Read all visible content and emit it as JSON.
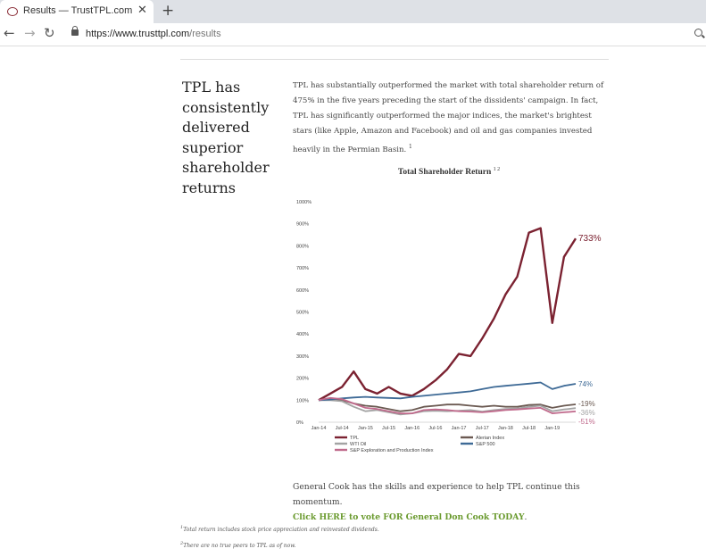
{
  "browser": {
    "tab_title": "Results — TrustTPL.com",
    "close_glyph": "✕",
    "newtab_glyph": "+",
    "url_host": "https://www.trusttpl.com",
    "url_path": "/results"
  },
  "page": {
    "headline": "TPL has consistently delivered superior shareholder returns",
    "intro": "TPL has substantially outperformed the market with total shareholder return of 475% in the five years preceding the start of the dissidents' campaign. In fact, TPL has significantly outperformed the major indices, the market's brightest stars (like Apple, Amazon and Facebook) and oil and gas companies invested heavily in the Permian Basin.",
    "intro_footnote_ref": "1",
    "chart_title": "Total Shareholder Return",
    "chart_title_refs": "1 2",
    "closing_text": "General Cook has the skills and experience to help TPL continue this momentum.",
    "cta_text": "Click HERE to vote FOR General Don Cook TODAY",
    "cta_suffix": ".",
    "footnote1_ref": "1",
    "footnote1": "Total return includes stock price appreciation and reinvested dividends.",
    "footnote2_ref": "2",
    "footnote2": "There are no true peers to TPL as of now."
  },
  "chart_data": {
    "type": "line",
    "ylim": [
      0,
      1000
    ],
    "yticks": [
      "0%",
      "100%",
      "200%",
      "300%",
      "400%",
      "500%",
      "600%",
      "700%",
      "800%",
      "900%",
      "1000%"
    ],
    "xticks": [
      "Jan-14",
      "Jul-14",
      "Jan-15",
      "Jul-15",
      "Jan-16",
      "Jul-16",
      "Jan-17",
      "Jul-17",
      "Jan-18",
      "Jul-18",
      "Jan-19"
    ],
    "x": [
      0,
      3,
      6,
      9,
      12,
      15,
      18,
      21,
      24,
      27,
      30,
      33,
      36,
      39,
      42,
      45,
      48,
      51,
      54,
      57,
      60,
      63,
      66
    ],
    "series": [
      {
        "name": "TPL",
        "color": "#7b2231",
        "end_label": "733%",
        "values": [
          100,
          130,
          160,
          230,
          150,
          130,
          160,
          130,
          120,
          150,
          190,
          240,
          310,
          300,
          380,
          470,
          580,
          660,
          860,
          880,
          450,
          750,
          833
        ]
      },
      {
        "name": "Alerian Index",
        "color": "#6b5a52",
        "end_label": "-19%",
        "values": [
          100,
          105,
          100,
          85,
          75,
          70,
          60,
          50,
          55,
          70,
          75,
          80,
          80,
          75,
          70,
          75,
          70,
          70,
          78,
          80,
          65,
          75,
          81
        ]
      },
      {
        "name": "WTI Oil",
        "color": "#a3a3a3",
        "end_label": "-36%",
        "values": [
          100,
          100,
          95,
          70,
          50,
          55,
          45,
          35,
          40,
          50,
          52,
          50,
          52,
          55,
          48,
          55,
          60,
          62,
          70,
          75,
          50,
          58,
          64
        ]
      },
      {
        "name": "S&P 500",
        "color": "#3e6a96",
        "end_label": "74%",
        "values": [
          100,
          103,
          108,
          112,
          115,
          112,
          110,
          108,
          115,
          120,
          125,
          130,
          135,
          140,
          150,
          160,
          165,
          170,
          175,
          180,
          150,
          165,
          174
        ]
      },
      {
        "name": "S&P Exploration and Production Index",
        "color": "#c06a8c",
        "end_label": "-51%",
        "values": [
          100,
          110,
          105,
          85,
          65,
          60,
          50,
          40,
          40,
          55,
          58,
          55,
          50,
          48,
          45,
          50,
          55,
          58,
          62,
          65,
          40,
          45,
          49
        ]
      }
    ]
  }
}
